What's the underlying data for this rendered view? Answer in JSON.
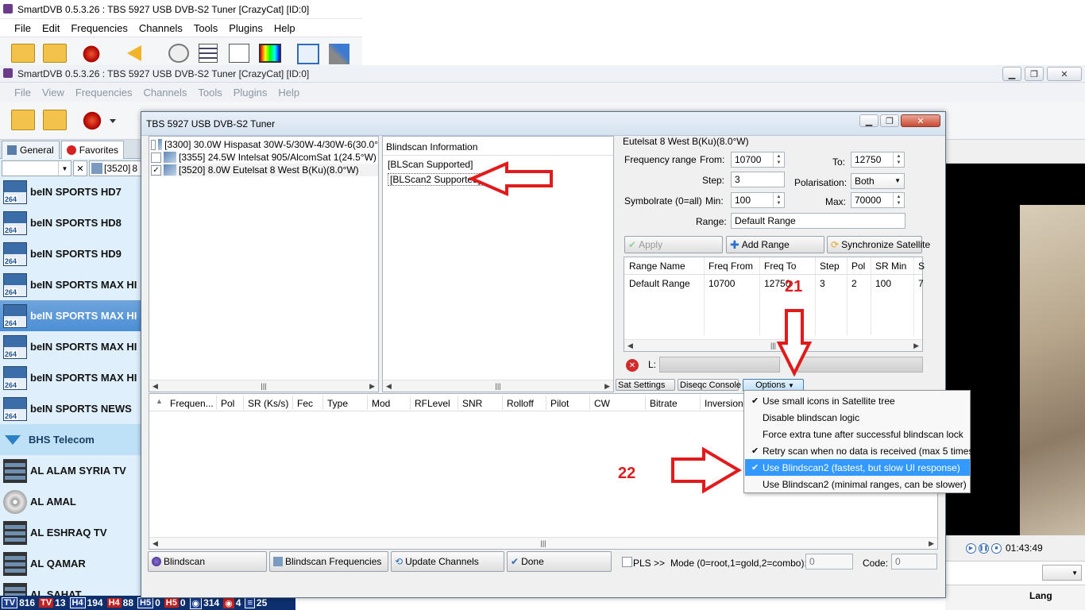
{
  "back_window": {
    "title": "SmartDVB 0.5.3.26 : TBS 5927 USB DVB-S2 Tuner [CrazyCat] [ID:0]",
    "menu": [
      "File",
      "Edit",
      "Frequencies",
      "Channels",
      "Tools",
      "Plugins",
      "Help"
    ]
  },
  "main_window": {
    "title": "SmartDVB 0.5.3.26 : TBS 5927 USB DVB-S2 Tuner [CrazyCat] [ID:0]",
    "menu": [
      "File",
      "View",
      "Frequencies",
      "Channels",
      "Tools",
      "Plugins",
      "Help"
    ],
    "time": "01:43:49",
    "lang_label": "Lang"
  },
  "channel_panel": {
    "tabs": [
      "General",
      "Favorites"
    ],
    "filter_sat": "[3520]",
    "filter_sat_cut": "8",
    "channels": [
      {
        "name": "beIN SPORTS HD7",
        "icon": "h264-channel-icon"
      },
      {
        "name": "beIN SPORTS HD8",
        "icon": "h264-channel-icon"
      },
      {
        "name": "beIN SPORTS HD9",
        "icon": "h264-channel-icon"
      },
      {
        "name": "beIN SPORTS MAX HI",
        "icon": "h264-film-icon"
      },
      {
        "name": "beIN SPORTS MAX HI",
        "icon": "h264-film-icon",
        "selected": true
      },
      {
        "name": "beIN SPORTS MAX HI",
        "icon": "h264-film-icon"
      },
      {
        "name": "beIN SPORTS MAX HI",
        "icon": "h264-film-icon"
      },
      {
        "name": "beIN SPORTS NEWS",
        "icon": "h264-film-icon"
      },
      {
        "name": "BHS Telecom",
        "icon": "group-triangle-icon",
        "group": true
      },
      {
        "name": "AL ALAM SYRIA TV",
        "icon": "film-icon"
      },
      {
        "name": "AL AMAL",
        "icon": "disc-icon"
      },
      {
        "name": "AL ESHRAQ TV",
        "icon": "film-icon"
      },
      {
        "name": "AL QAMAR",
        "icon": "film-icon"
      },
      {
        "name": "AL SAHAT",
        "icon": "film-icon"
      }
    ]
  },
  "statusbar": {
    "items": [
      {
        "badge": "TV",
        "value": "816"
      },
      {
        "badge": "TV",
        "value": "13"
      },
      {
        "badge": "H4",
        "value": "194"
      },
      {
        "badge": "H4",
        "value": "88"
      },
      {
        "badge": "H5",
        "value": "0"
      },
      {
        "badge": "H5",
        "value": "0"
      },
      {
        "badge": "◉",
        "value": "314"
      },
      {
        "badge": "◉",
        "value": "4"
      },
      {
        "badge": "≡",
        "value": "25"
      }
    ]
  },
  "dialog": {
    "title": "TBS 5927 USB DVB-S2 Tuner",
    "satellites": [
      {
        "text": "[3300]  30.0W  Hispasat 30W-5/30W-4/30W-6(30.0°",
        "checked": false
      },
      {
        "text": "[3355]  24.5W  Intelsat 905/AlcomSat 1(24.5°W)",
        "checked": false
      },
      {
        "text": "[3520]  8.0W  Eutelsat 8 West B(Ku)(8.0°W)",
        "checked": true
      }
    ],
    "blindscan_info_header": "Blindscan Information",
    "blindscan_info": [
      "[BLScan Supported]",
      "[BLScan2 Supported]"
    ],
    "sat_name": "Eutelsat 8 West B(Ku)(8.0°W)",
    "frequency_range_label": "Frequency range",
    "from_label": "From:",
    "from_value": "10700",
    "to_label": "To:",
    "to_value": "12750",
    "step_label": "Step:",
    "step_value": "3",
    "polarisation_label": "Polarisation:",
    "polarisation_value": "Both",
    "symbolrate_label": "Symbolrate (0=all)",
    "min_label": "Min:",
    "min_value": "100",
    "max_label": "Max:",
    "max_value": "70000",
    "range_label": "Range:",
    "range_value": "Default Range",
    "apply": "Apply",
    "add_range": "Add Range",
    "sync_satellite": "Synchronize Satellite",
    "range_table": {
      "headers": [
        "Range Name",
        "Freq From",
        "Freq To",
        "Step",
        "Pol",
        "SR Min",
        "S"
      ],
      "rows": [
        [
          "Default Range",
          "10700",
          "12750",
          "3",
          "2",
          "100",
          "7"
        ]
      ]
    },
    "level_label": "L:",
    "quality_label": "Q:",
    "sat_settings": "Sat Settings",
    "diseqc_console": "Diseqc Console",
    "options": "Options",
    "results_headers": [
      "Frequen...",
      "Pol",
      "SR (Ks/s)",
      "Fec",
      "Type",
      "Mod",
      "RFLevel",
      "SNR",
      "Rolloff",
      "Pilot",
      "CW",
      "Bitrate",
      "Inversion"
    ],
    "blindscan_btn": "Blindscan",
    "blindscan_freq_btn": "Blindscan Frequencies",
    "update_channels_btn": "Update Channels",
    "done_btn": "Done",
    "pls_label": "PLS >>",
    "mode_label": "Mode (0=root,1=gold,2=combo):",
    "mode_value": "0",
    "code_label": "Code:",
    "code_value": "0"
  },
  "options_menu": [
    {
      "label": "Use small icons in Satellite tree",
      "checked": true
    },
    {
      "label": "Disable blindscan logic",
      "checked": false
    },
    {
      "label": "Force extra tune after successful blindscan lock",
      "checked": false
    },
    {
      "label": "Retry scan when no data is received (max 5 times)",
      "checked": true
    },
    {
      "label": "Use Blindscan2 (fastest, but slow UI response)",
      "checked": true,
      "highlighted": true
    },
    {
      "label": "Use Blindscan2 (minimal ranges, can be slower)",
      "checked": false
    }
  ],
  "annotations": {
    "step21": "21",
    "step22": "22"
  },
  "colors": {
    "accent_red": "#e11b1b",
    "highlight_blue": "#3399ff",
    "selected_row": "#4d8fd6"
  }
}
